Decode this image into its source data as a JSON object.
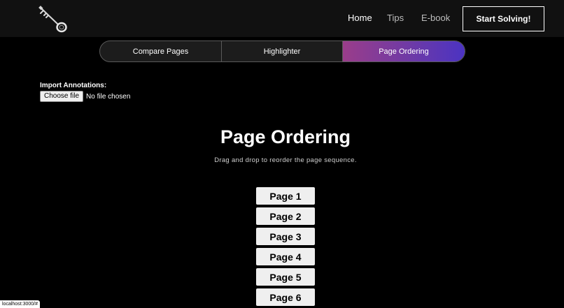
{
  "nav": {
    "logo_icon": "key-icon",
    "links": [
      {
        "label": "Home"
      },
      {
        "label": "Tips"
      },
      {
        "label": "E-book"
      }
    ],
    "cta_label": "Start Solving!"
  },
  "tabs": [
    {
      "label": "Compare Pages",
      "active": false
    },
    {
      "label": "Highlighter",
      "active": false
    },
    {
      "label": "Page Ordering",
      "active": true
    }
  ],
  "import": {
    "label": "Import Annotations:",
    "button_label": "Choose file",
    "status": "No file chosen"
  },
  "main": {
    "title": "Page Ordering",
    "subtitle": "Drag and drop to reorder the page sequence.",
    "pages": [
      {
        "label": "Page 1"
      },
      {
        "label": "Page 2"
      },
      {
        "label": "Page 3"
      },
      {
        "label": "Page 4"
      },
      {
        "label": "Page 5"
      },
      {
        "label": "Page 6"
      }
    ]
  },
  "status_bar": {
    "url": "localhost:3000/#"
  },
  "colors": {
    "background": "#000000",
    "navbar": "#111111",
    "active_tab_gradient_start": "#9a3d8a",
    "active_tab_gradient_end": "#4b33c2",
    "page_item_bg": "#efefef"
  }
}
